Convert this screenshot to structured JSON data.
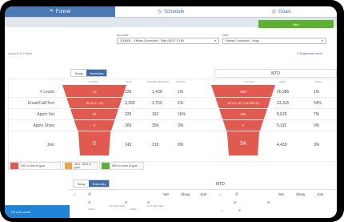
{
  "nav": {
    "tabs": [
      {
        "label": "Funnel",
        "icon": "funnel-icon"
      },
      {
        "label": "Schedule",
        "icon": "clock-icon"
      },
      {
        "label": "Goals",
        "icon": "target-icon"
      }
    ]
  },
  "toolbar": {
    "new_label": "New"
  },
  "filters": {
    "accounts_label": "Accounts:",
    "accounts_value": "2118008 -- Fitness Connection - Titan (NEXT GYM)",
    "date_label": "Date:",
    "date_value": "Fitness Connection - Irving"
  },
  "meta": {
    "updated_text": "Updated at 3:08pm",
    "regenerate_label": "Regenerate report"
  },
  "top": {
    "toggle": [
      "Today",
      "Yesterday"
    ],
    "mtd_title": "MTD",
    "col_heads_left": [
      "ACTUAL",
      "GOAL",
      "PROJECTED GOAL",
      "ACTUAL"
    ],
    "col_heads_right": [
      "ACTUAL",
      "GOAL",
      "PROJ"
    ],
    "rows": [
      {
        "label": "Leads",
        "left_actual": "13",
        "goal": "220",
        "proj": "1,439",
        "pct": "1%",
        "right_actual": "200",
        "right_goal": "20,385",
        "right_pct": "1%"
      },
      {
        "label": "Email/Call/Text",
        "left_actual": "25 (8 /17 /0)",
        "goal": "2,200",
        "proj": "2,753",
        "pct": "1%",
        "right_actual": "13,147 (67 /13,080 /0)",
        "right_goal": "23,315",
        "right_pct": "54%"
      },
      {
        "label": "Appts Set",
        "left_actual": "37",
        "goal": "220",
        "proj": "332",
        "pct": "16%",
        "right_actual": "181",
        "right_goal": "8,625",
        "right_pct": "7%"
      },
      {
        "label": "Appts Show",
        "left_actual": "0",
        "goal": "165",
        "proj": "256",
        "pct": "0%",
        "right_actual": "4",
        "right_goal": "5,115",
        "right_pct": "0%"
      },
      {
        "label": "Join",
        "left_actual": "0",
        "goal": "143",
        "proj": "219",
        "pct": "0%",
        "right_actual": "54",
        "right_goal": "4,433",
        "right_pct": "3%"
      }
    ]
  },
  "legend": [
    {
      "label": "26% or less of goal",
      "color": "#e05a4f"
    },
    {
      "label": "35% - 85% of goal",
      "color": "#f0a33a"
    },
    {
      "label": "85% or more of goal",
      "color": "#5cb130"
    }
  ],
  "bottom": {
    "toggle": [
      "Today",
      "Yesterday"
    ],
    "mtd_title": "MTD",
    "heads": [
      "Set",
      "Show",
      "Join",
      "Set",
      "Show",
      "Join"
    ],
    "sub_heads": [
      "INSIDE",
      "FAST DUE (2/EO)",
      "INSIDE",
      "FAST DUE (2/EO)"
    ]
  },
  "chat": {
    "label": "Hi! Let's chat!"
  },
  "colors": {
    "accent": "#3d6ea8",
    "funnel": "#e05a4f",
    "green": "#5cb130"
  }
}
